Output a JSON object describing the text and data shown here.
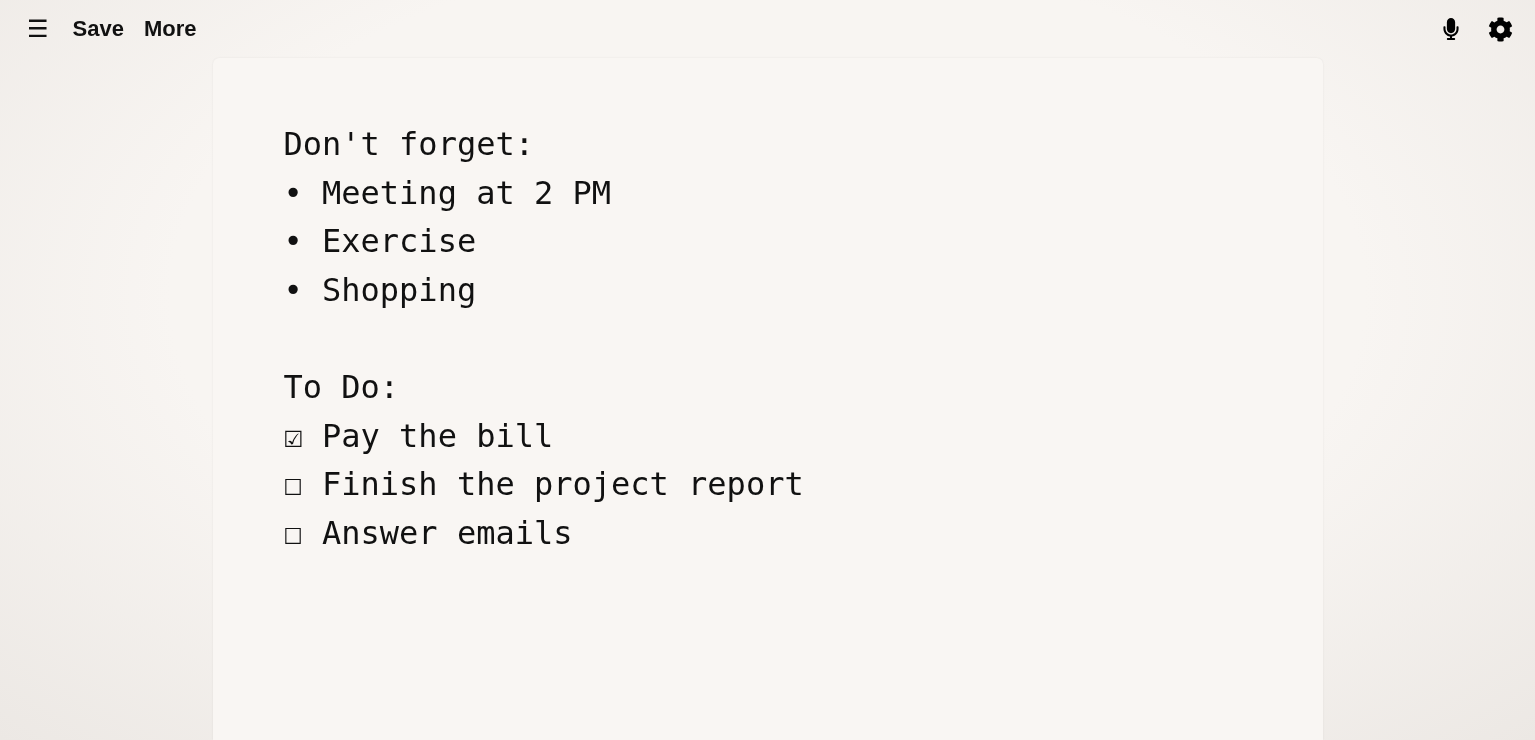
{
  "toolbar": {
    "menu": "☰",
    "buttons": [
      "Save",
      "More"
    ]
  },
  "note": {
    "sections": [
      {
        "heading": "Don't forget:",
        "lines": [
          "• Meeting at 2 PM",
          "• Exercise",
          "• Shopping"
        ]
      },
      {
        "heading": "To Do:",
        "lines": [
          "☑ Pay the bill",
          "☐ Finish the project report",
          "☐ Answer emails"
        ]
      }
    ]
  }
}
